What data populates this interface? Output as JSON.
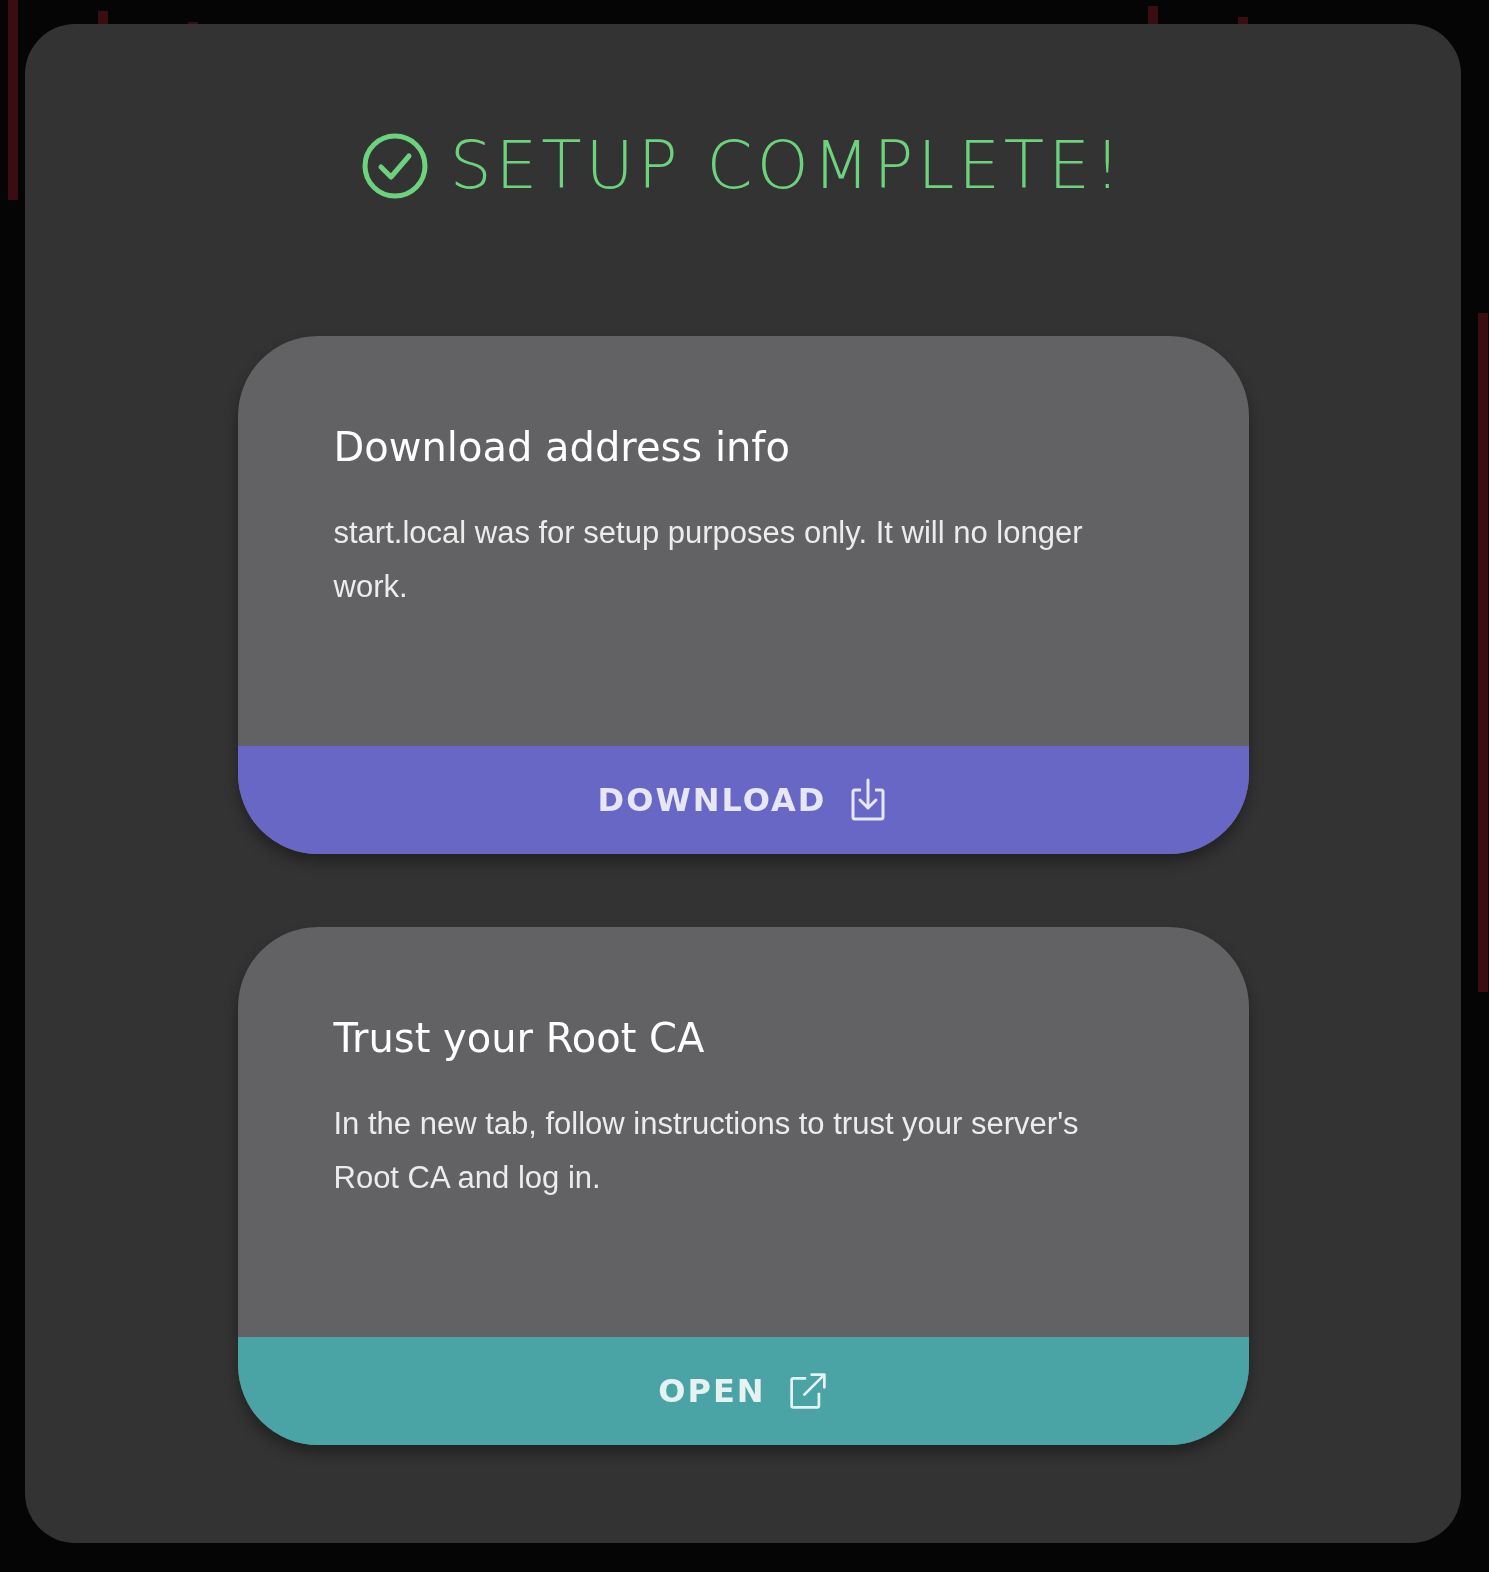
{
  "title": "SETUP COMPLETE!",
  "cards": [
    {
      "heading": "Download address info",
      "body": "start.local was for setup purposes only. It will no longer work.",
      "button": {
        "label": "DOWNLOAD",
        "kind": "download"
      }
    },
    {
      "heading": "Trust your Root CA",
      "body": "In the new tab, follow instructions to trust your server's Root CA and log in.",
      "button": {
        "label": "OPEN",
        "kind": "open"
      }
    }
  ]
}
